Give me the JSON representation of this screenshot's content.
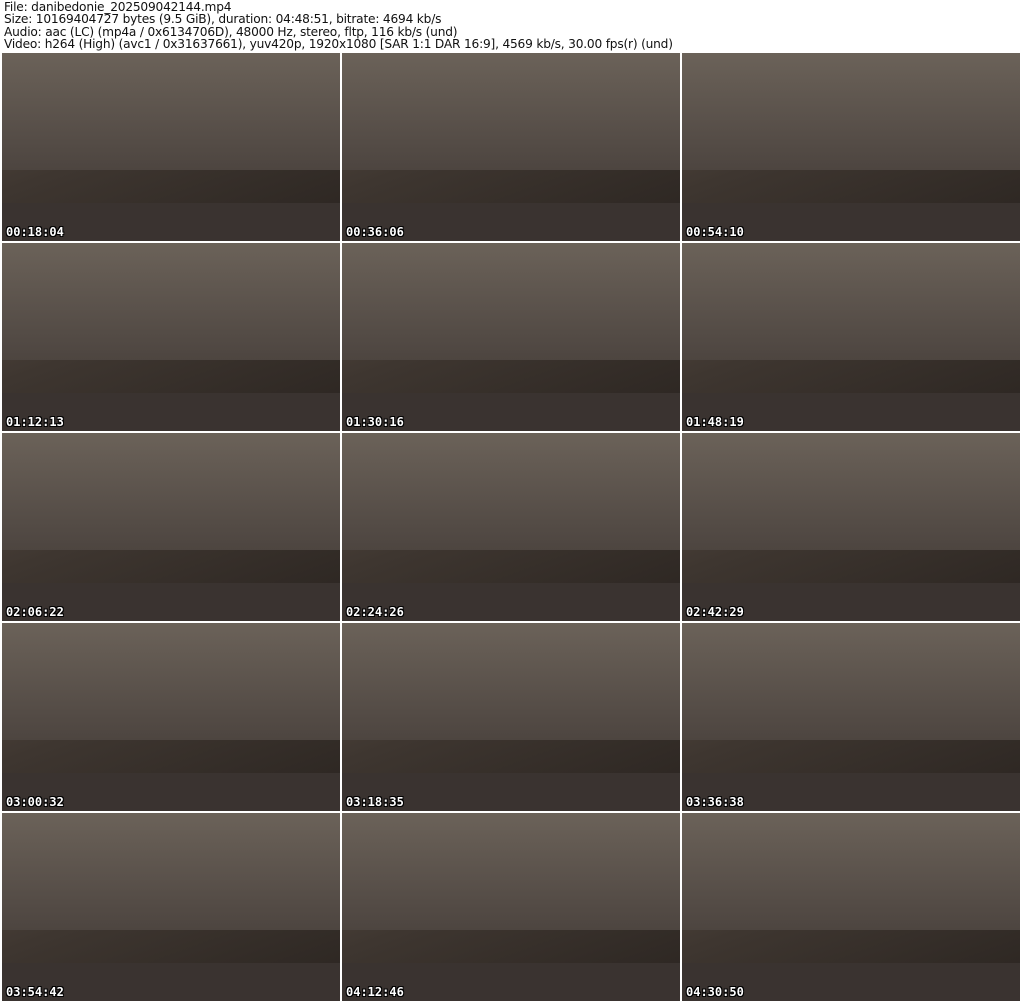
{
  "header": {
    "file": "File: danibedonie_202509042144.mp4",
    "size": "Size: 10169404727 bytes (9.5 GiB), duration: 04:48:51, bitrate: 4694 kb/s",
    "audio": "Audio: aac (LC) (mp4a / 0x6134706D), 48000 Hz, stereo, fltp, 116 kb/s (und)",
    "video": "Video: h264 (High) (avc1 / 0x31637661), yuv420p, 1920x1080 [SAR 1:1 DAR 16:9], 4569 kb/s, 30.00 fps(r) (und)"
  },
  "thumbnails": [
    {
      "timestamp": "00:18:04"
    },
    {
      "timestamp": "00:36:06"
    },
    {
      "timestamp": "00:54:10"
    },
    {
      "timestamp": "01:12:13"
    },
    {
      "timestamp": "01:30:16"
    },
    {
      "timestamp": "01:48:19"
    },
    {
      "timestamp": "02:06:22"
    },
    {
      "timestamp": "02:24:26"
    },
    {
      "timestamp": "02:42:29"
    },
    {
      "timestamp": "03:00:32"
    },
    {
      "timestamp": "03:18:35"
    },
    {
      "timestamp": "03:36:38"
    },
    {
      "timestamp": "03:54:42"
    },
    {
      "timestamp": "04:12:46"
    },
    {
      "timestamp": "04:30:50"
    }
  ]
}
